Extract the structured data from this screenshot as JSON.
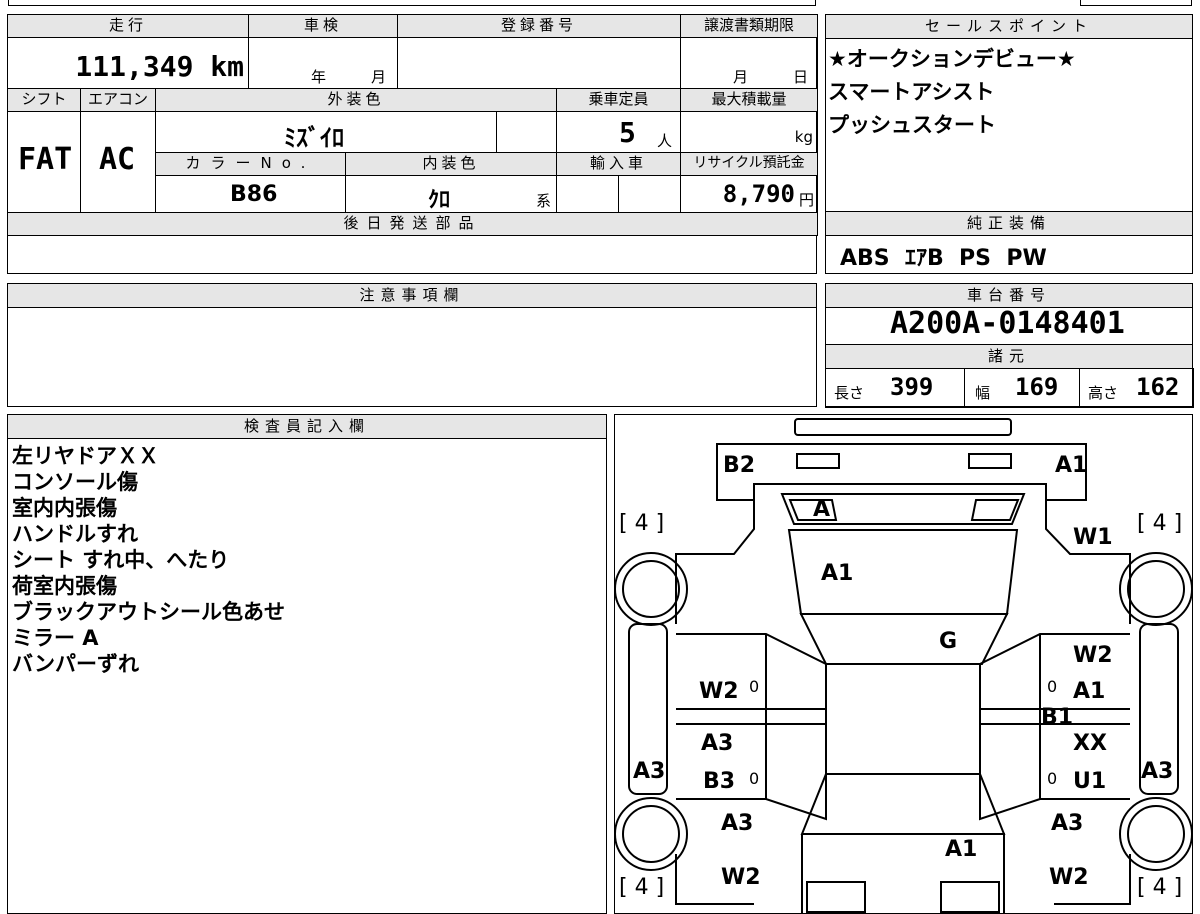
{
  "vehicle_info": {
    "mileage_label": "走行",
    "mileage_value": "111,349 km",
    "inspection_label": "車検",
    "inspection_year_unit": "年",
    "inspection_month_unit": "月",
    "registration_label": "登録番号",
    "transfer_deadline_label": "譲渡書類期限",
    "transfer_month_unit": "月",
    "transfer_day_unit": "日",
    "shift_label": "シフト",
    "shift_value": "FAT",
    "aircon_label": "エアコン",
    "aircon_value": "AC",
    "exterior_color_label": "外装色",
    "exterior_color_value": "ﾐｽﾞｲﾛ",
    "capacity_label": "乗車定員",
    "capacity_value": "5",
    "capacity_unit": "人",
    "max_load_label": "最大積載量",
    "max_load_unit": "kg",
    "color_no_label": "カラーNo.",
    "color_no_value": "B86",
    "interior_color_label": "内装色",
    "interior_color_value": "ｸﾛ",
    "interior_color_suffix": "系",
    "import_label": "輸入車",
    "recycle_label": "リサイクル預託金",
    "recycle_value": "8,790",
    "recycle_unit": "円",
    "later_parts_label": "後日発送部品"
  },
  "sales_points": {
    "label": "セールスポイント",
    "lines": [
      "★オークションデビュー★",
      "スマートアシスト",
      "プッシュスタート"
    ]
  },
  "equipment": {
    "label": "純正装備",
    "value": "ABS  ｴｱB  PS  PW"
  },
  "notes": {
    "label": "注意事項欄"
  },
  "chassis": {
    "label": "車台番号",
    "value": "A200A-0148401"
  },
  "specs": {
    "label": "諸元",
    "length_label": "長さ",
    "length_value": "399",
    "width_label": "幅",
    "width_value": "169",
    "height_label": "高さ",
    "height_value": "162"
  },
  "inspector": {
    "label": "検査員記入欄",
    "lines": [
      "左リヤドアＸＸ",
      "コンソール傷",
      "室内内張傷",
      "ハンドルすれ",
      "シート すれ中、へたり",
      "荷室内張傷",
      "ブラックアウトシール色あせ",
      "ミラー A",
      "バンパーずれ"
    ]
  },
  "diagram": {
    "tire_marks": [
      "[ 4 ]",
      "[ 4 ]",
      "[ 4 ]",
      "[ 4 ]"
    ],
    "labels": {
      "rear_left": "B2",
      "rear_right": "A1",
      "rear_window": "A",
      "rear_glass_w1": "W1",
      "roof_a1": "A1",
      "glass_g": "G",
      "right_w2": "W2",
      "right_a1": "A1",
      "right_b1": "B1",
      "right_xx": "XX",
      "right_u1": "U1",
      "left_w2": "W2",
      "left_a3": "A3",
      "left_b3": "B3",
      "left_sill_a3": "A3",
      "right_sill_a3": "A3",
      "front_left_a3": "A3",
      "front_right_a3": "A3",
      "hood_a1": "A1",
      "front_w2_left": "W2",
      "front_w2_right": "W2",
      "zero1": "0",
      "zero2": "0",
      "zero3": "0",
      "zero4": "0"
    }
  }
}
